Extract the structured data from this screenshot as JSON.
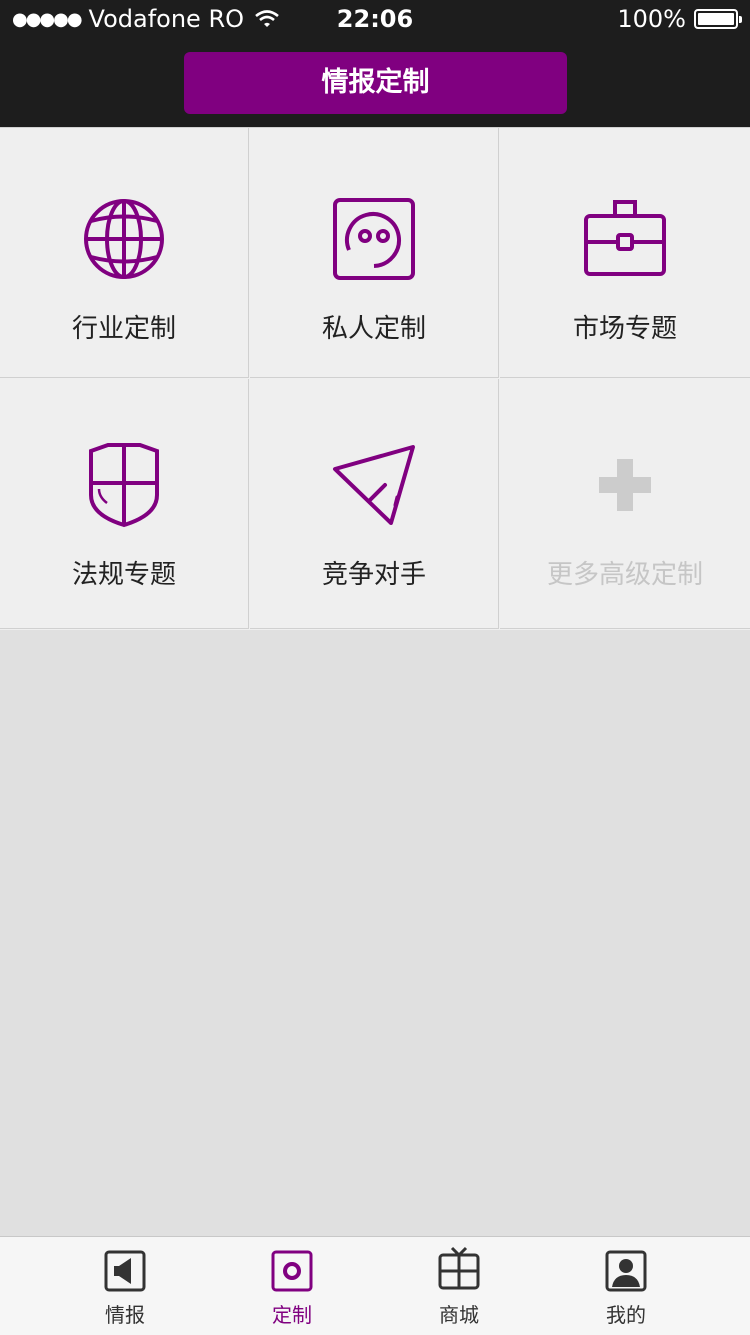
{
  "status_bar": {
    "signal_dots": "●●●●●",
    "carrier": "Vodafone RO",
    "time": "22:06",
    "battery": "100%"
  },
  "header": {
    "title": "情报定制"
  },
  "grid": {
    "items": [
      {
        "label": "行业定制",
        "icon": "globe-icon"
      },
      {
        "label": "私人定制",
        "icon": "face-icon"
      },
      {
        "label": "市场专题",
        "icon": "briefcase-icon"
      },
      {
        "label": "法规专题",
        "icon": "shield-icon"
      },
      {
        "label": "竞争对手",
        "icon": "paper-plane-icon"
      },
      {
        "label": "更多高级定制",
        "icon": "plus-icon"
      }
    ]
  },
  "tab_bar": {
    "tabs": [
      {
        "label": "情报",
        "icon": "speaker-icon"
      },
      {
        "label": "定制",
        "icon": "custom-icon",
        "active": true
      },
      {
        "label": "商城",
        "icon": "gift-icon"
      },
      {
        "label": "我的",
        "icon": "user-icon"
      }
    ]
  },
  "colors": {
    "accent": "#800080",
    "bar_background": "#1d1d1d",
    "grid_background": "#efefef",
    "page_background": "#e0e0e0",
    "disabled": "#c6c6c6"
  }
}
